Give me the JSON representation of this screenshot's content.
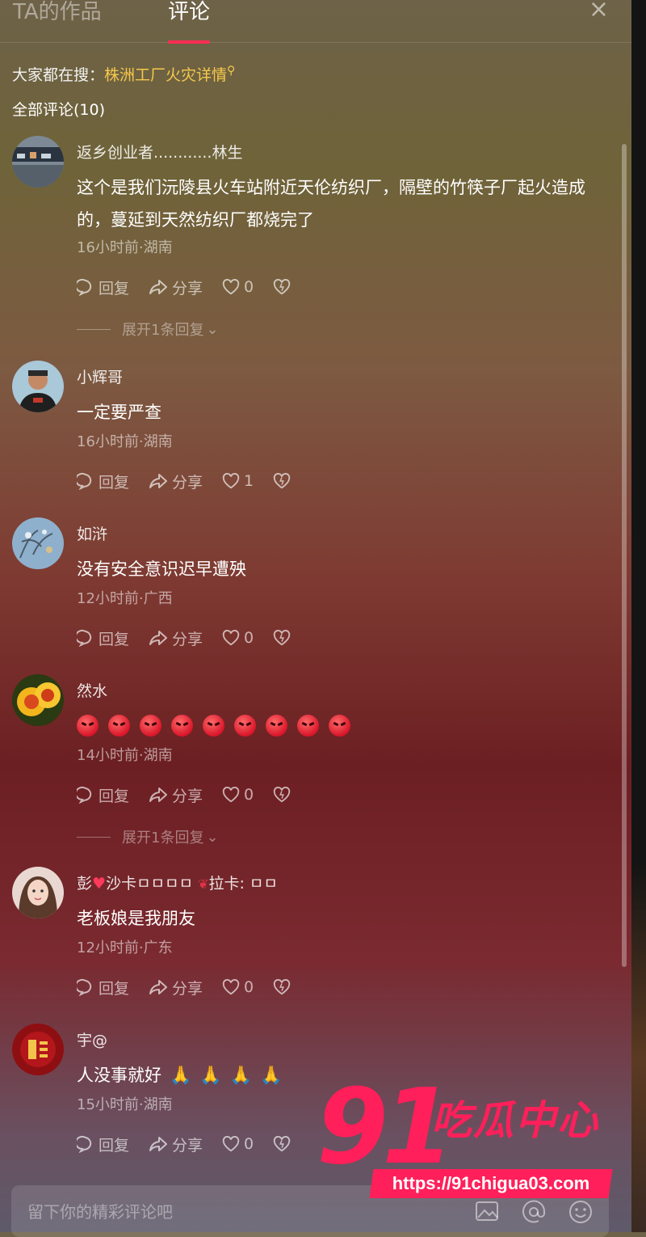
{
  "tabs": {
    "works": "TA的作品",
    "comments": "评论",
    "close": "×"
  },
  "hot_search": {
    "prefix": "大家都在搜：",
    "term": "株洲工厂火灾详情"
  },
  "comment_count": "全部评论(10)",
  "actions": {
    "reply": "回复",
    "share": "分享"
  },
  "comments": [
    {
      "name": "返乡创业者............林生",
      "text": "这个是我们沅陵县火车站附近天伦纺织厂，隔壁的竹筷子厂起火造成的，蔓延到天然纺织厂都烧完了",
      "meta": "16小时前·湖南",
      "likes": "0",
      "expand": "展开1条回复"
    },
    {
      "name": "小辉哥",
      "text": "一定要严查",
      "meta": "16小时前·湖南",
      "likes": "1"
    },
    {
      "name": "如浒",
      "text": "没有安全意识迟早遭殃",
      "meta": "12小时前·广西",
      "likes": "0"
    },
    {
      "name": "然水",
      "text": "",
      "emoji_count": 9,
      "meta": "14小时前·湖南",
      "likes": "0",
      "expand": "展开1条回复"
    },
    {
      "name_a": "彭",
      "name_b": "沙卡ㅁㅁㅁㅁ",
      "name_c": "拉卡: ㅁㅁ",
      "text": "老板娘是我朋友",
      "meta": "12小时前·广东",
      "likes": "0"
    },
    {
      "name": "宇@",
      "text": "人没事就好",
      "meta": "15小时前·湖南",
      "likes": "0"
    }
  ],
  "input": {
    "placeholder": "留下你的精彩评论吧"
  },
  "watermark": {
    "big": "91",
    "cn": "吃瓜中心",
    "url": "https://91chigua03.com"
  },
  "colors": {
    "accent": "#fe2c55",
    "hot_link": "#f6c84b",
    "watermark": "#ff1f5a"
  }
}
